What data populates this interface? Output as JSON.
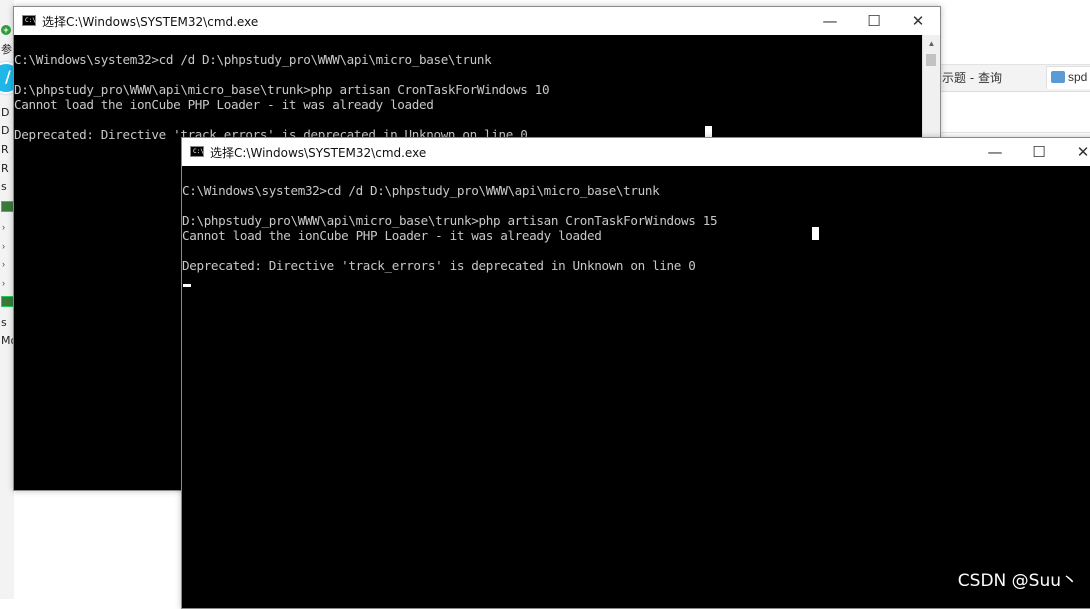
{
  "background": {
    "left_fragments": [
      "参",
      "D",
      "D",
      "R",
      "R",
      "s",
      "s",
      "Mo"
    ],
    "right_tabs": [
      {
        "label": "示题 - 查询"
      },
      {
        "label": "spd"
      }
    ],
    "logo_glyph": "/"
  },
  "back_window": {
    "title": "选择C:\\Windows\\SYSTEM32\\cmd.exe",
    "controls": {
      "minimize": "—",
      "maximize": "☐",
      "close": "✕"
    },
    "lines": [
      "C:\\Windows\\system32>cd /d D:\\phpstudy_pro\\WWW\\api\\micro_base\\trunk",
      "",
      "D:\\phpstudy_pro\\WWW\\api\\micro_base\\trunk>php artisan CronTaskForWindows 10",
      "Cannot load the ionCube PHP Loader - it was already loaded",
      "",
      "Deprecated: Directive 'track_errors' is deprecated in Unknown on line 0"
    ]
  },
  "front_window": {
    "title": "选择C:\\Windows\\SYSTEM32\\cmd.exe",
    "controls": {
      "minimize": "—",
      "maximize": "☐",
      "close": "✕"
    },
    "lines": [
      "C:\\Windows\\system32>cd /d D:\\phpstudy_pro\\WWW\\api\\micro_base\\trunk",
      "",
      "D:\\phpstudy_pro\\WWW\\api\\micro_base\\trunk>php artisan CronTaskForWindows 15",
      "Cannot load the ionCube PHP Loader - it was already loaded",
      "",
      "Deprecated: Directive 'track_errors' is deprecated in Unknown on line 0"
    ]
  },
  "watermark": "CSDN @Suu丶",
  "colors": {
    "console_bg": "#000000",
    "console_text": "#c8c8c8",
    "titlebar_bg": "#ffffff"
  }
}
